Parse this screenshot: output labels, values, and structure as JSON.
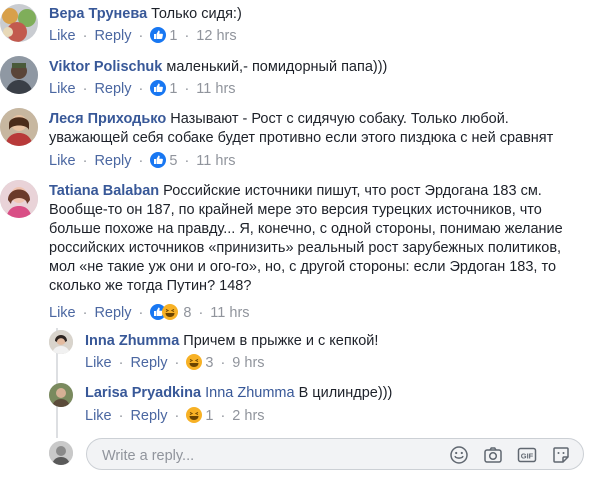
{
  "actions": {
    "like": "Like",
    "reply": "Reply",
    "separator": "·"
  },
  "comments": [
    {
      "author": "Вера Трунева",
      "text": "Только сидя:)",
      "reaction_count": "1",
      "time": "12 hrs",
      "reactions": [
        "like-reaction"
      ]
    },
    {
      "author": "Viktor Polischuk",
      "text": "маленький,- помидорный папа)))",
      "reaction_count": "1",
      "time": "11 hrs",
      "reactions": [
        "like-reaction"
      ]
    },
    {
      "author": "Леся Приходько",
      "text_line1": "Называют - Рост с сидячую собаку. Только любой.",
      "text_line2": "уважающей себя собаке будет противно если этого пиздюка с ней сравнят",
      "reaction_count": "5",
      "time": "11 hrs",
      "reactions": [
        "like-reaction"
      ]
    },
    {
      "author": "Tatiana Balaban",
      "text_line1": "Российские источники пишут, что рост Эрдогана 183 см.",
      "text_line2": "Вообще-то он 187, по крайней мере это версия турецких источников, что",
      "text_line3": "больше похоже на правду... Я, конечно, с одной стороны, понимаю желание",
      "text_line4": "российских источников «принизить» реальный рост зарубежных политиков,",
      "text_line5": "мол «не такие уж они и ого-го», но, с другой стороны: если Эрдоган 183, то",
      "text_line6": "сколько же тогда Путин? 148?",
      "reaction_count": "8",
      "time": "11 hrs",
      "reactions": [
        "like-reaction",
        "haha-reaction"
      ]
    }
  ],
  "replies": [
    {
      "author": "Inna Zhumma",
      "text": "Причем в прыжке и с кепкой!",
      "reaction_count": "3",
      "time": "9 hrs",
      "reactions": [
        "haha-reaction"
      ]
    },
    {
      "author": "Larisa Pryadkina",
      "mention": "Inna Zhumma",
      "text": "В цилиндре)))",
      "reaction_count": "1",
      "time": "2 hrs",
      "reactions": [
        "haha-reaction"
      ]
    }
  ],
  "reply_box": {
    "placeholder": "Write a reply...",
    "icons": [
      "emoji-icon",
      "camera-icon",
      "gif-icon",
      "sticker-icon"
    ]
  },
  "colors": {
    "link_blue": "#385898",
    "action_blue": "#4b67a1",
    "meta_gray": "#90949c",
    "like_blue": "#1877f2",
    "haha_yellow": "#f7b125"
  }
}
